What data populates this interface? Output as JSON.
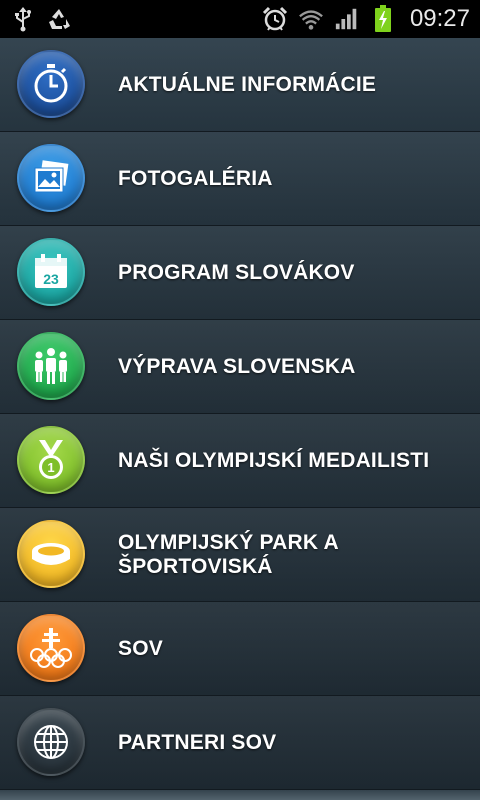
{
  "status_bar": {
    "time": "09:27",
    "icons": [
      "usb-icon",
      "recycle-icon",
      "alarm-icon",
      "wifi-icon",
      "signal-icon",
      "battery-charging-icon"
    ]
  },
  "menu": {
    "items": [
      {
        "label": "AKTUÁLNE INFORMÁCIE",
        "icon": "stopwatch-icon",
        "color": "#1c4e9a"
      },
      {
        "label": "FOTOGALÉRIA",
        "icon": "photo-gallery-icon",
        "color": "#1f7bd0"
      },
      {
        "label": "PROGRAM SLOVÁKOV",
        "icon": "calendar-icon",
        "color": "#1aa6a2",
        "calendar_day": "23"
      },
      {
        "label": "VÝPRAVA SLOVENSKA",
        "icon": "team-icon",
        "color": "#1fa84c"
      },
      {
        "label": "NAŠI OLYMPIJSKÍ MEDAILISTI",
        "icon": "medal-icon",
        "color": "#7fbf2a",
        "medal_number": "1"
      },
      {
        "label": "OLYMPIJSKÝ PARK A\nŠPORTOVISKÁ",
        "icon": "stadium-icon",
        "color": "#f2b824"
      },
      {
        "label": "SOV",
        "icon": "olympic-rings-icon",
        "color": "#f27a18"
      },
      {
        "label": "PARTNERI SOV",
        "icon": "globe-icon",
        "color": "#28333b"
      }
    ]
  }
}
